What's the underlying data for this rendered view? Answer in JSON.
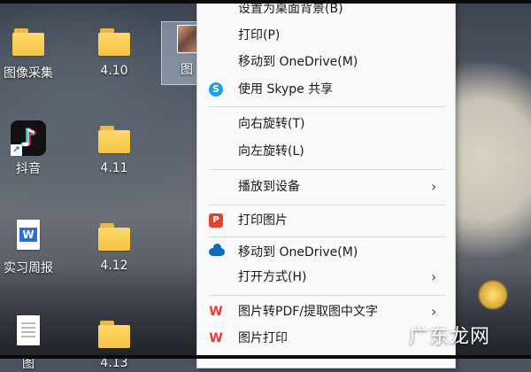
{
  "desktop": {
    "icons": [
      {
        "label": "图像采集",
        "type": "folder"
      },
      {
        "label": "4.10",
        "type": "folder"
      },
      {
        "label": "抖音",
        "type": "tiktok"
      },
      {
        "label": "4.11",
        "type": "folder"
      },
      {
        "label": "实习周报",
        "type": "word"
      },
      {
        "label": "4.12",
        "type": "folder"
      },
      {
        "label": "图",
        "type": "document"
      },
      {
        "label": "4.13",
        "type": "folder"
      }
    ],
    "selected_tile_label": "图"
  },
  "context_menu": {
    "items": [
      {
        "label": "设置为桌面背景(B)",
        "icon": ""
      },
      {
        "label": "打印(P)",
        "icon": ""
      },
      {
        "label": "移动到 OneDrive(M)",
        "icon": ""
      },
      {
        "label": "使用 Skype 共享",
        "icon": "skype-icon"
      },
      {
        "label": "向右旋转(T)",
        "icon": ""
      },
      {
        "label": "向左旋转(L)",
        "icon": ""
      },
      {
        "label": "播放到设备",
        "icon": "",
        "submenu": true
      },
      {
        "label": "打印图片",
        "icon": "pdf-print-icon"
      },
      {
        "label": "移动到 OneDrive(M)",
        "icon": "onedrive-cloud-icon"
      },
      {
        "label": "打开方式(H)",
        "icon": "",
        "submenu": true
      },
      {
        "label": "图片转PDF/提取图中文字",
        "icon": "wps-icon",
        "submenu": true
      },
      {
        "label": "图片打印",
        "icon": "wps-icon"
      }
    ],
    "submenu_arrow": "›"
  },
  "icons": {
    "skype": "S",
    "pdf": "P",
    "wps": "W",
    "word": "W",
    "tiktok": "♪",
    "shortcut_arrow": "↗"
  },
  "watermark": "广东龙网"
}
